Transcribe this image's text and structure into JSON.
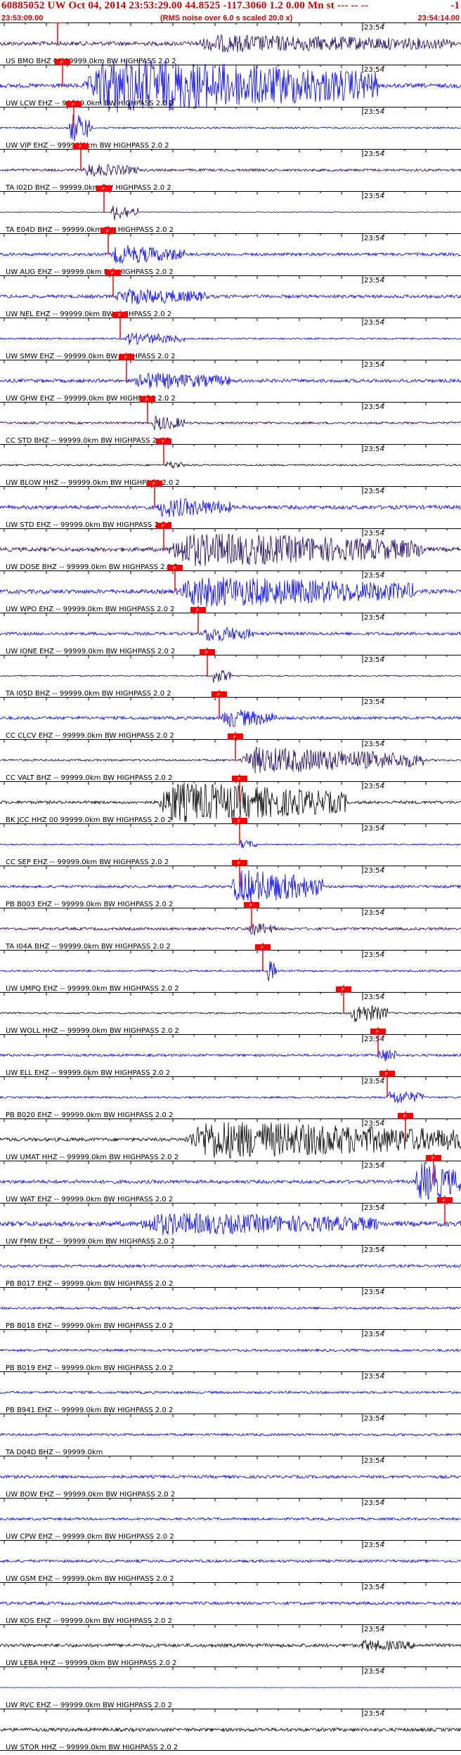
{
  "header": {
    "title": "60885052 UW Oct 04, 2014 23:53:29.00   44.8525 -117.3060  1.2 0.00 Mn st --- -- --",
    "trailing": "-1",
    "start_time": "23:53:09.00",
    "note": "(RMS noise over 6.0 s scaled 20.0 x)",
    "end_time": "23:54:14.00"
  },
  "tick_label": "23:54",
  "pick_label": "P",
  "colors": {
    "header": "#d40000",
    "pick": "#ff0000",
    "blue": "#0000ff",
    "navy": "#1a0066",
    "black": "#000000"
  },
  "traces": [
    {
      "label": "US BMO BHZ 00 99999.0km BW  HIGHPASS  2.0  2",
      "color": "#1a0066",
      "amp": 0.3,
      "burst": [
        0.42,
        0.98,
        1.0
      ],
      "pick": 0.125
    },
    {
      "label": "UW LCW EHZ -- 99999.0km BW  HIGHPASS  2.0  2",
      "color": "#0000ff",
      "amp": 0.3,
      "burst": [
        0.18,
        0.82,
        3.8
      ],
      "pick": 0.135
    },
    {
      "label": "UW VIP EHZ -- 99999.0km BW  HIGHPASS  2.0  2",
      "color": "#0000ff",
      "amp": 0.12,
      "burst": [
        0.15,
        0.2,
        2.2
      ],
      "pick": 0.16
    },
    {
      "label": "TA I02D BHZ -- 99999.0km BW  HIGHPASS  2.0  2",
      "color": "#1a0066",
      "amp": 0.18,
      "burst": [
        0.18,
        0.3,
        0.8
      ],
      "pick": 0.175
    },
    {
      "label": "TA E04D BHZ -- 99999.0km BW  HIGHPASS  2.0  2",
      "color": "#1a0066",
      "amp": 0.05,
      "burst": [
        0.24,
        0.3,
        1.2
      ],
      "pick": 0.225
    },
    {
      "label": "UW AUG EHZ -- 99999.0km BW  HIGHPASS  2.0  2",
      "color": "#0000ff",
      "amp": 0.22,
      "burst": [
        0.24,
        0.4,
        1.2
      ],
      "pick": 0.235
    },
    {
      "label": "UW NEL EHZ -- 99999.0km BW  HIGHPASS  2.0  2",
      "color": "#0000ff",
      "amp": 0.24,
      "burst": [
        0.25,
        0.45,
        1.0
      ],
      "pick": 0.245
    },
    {
      "label": "UW SMW EHZ -- 99999.0km BW  HIGHPASS  2.0  2",
      "color": "#0000ff",
      "amp": 0.12,
      "burst": [
        0.27,
        0.4,
        0.8
      ],
      "pick": 0.26
    },
    {
      "label": "UW GHW EHZ -- 99999.0km BW  HIGHPASS  2.0  2",
      "color": "#0000ff",
      "amp": 0.25,
      "burst": [
        0.29,
        0.5,
        1.0
      ],
      "pick": 0.275
    },
    {
      "label": "CC STD BHZ -- 99999.0km BW  HIGHPASS  2.0  2",
      "color": "#1a0066",
      "amp": 0.16,
      "burst": [
        0.33,
        0.4,
        1.0
      ],
      "pick": 0.32
    },
    {
      "label": "UW BLOW HHZ -- 99999.0km BW  HIGHPASS  2.0  2",
      "color": "#000000",
      "amp": 0.12,
      "burst": [
        0.36,
        0.4,
        0.5
      ],
      "pick": 0.355
    },
    {
      "label": "UW STD EHZ -- 99999.0km BW  HIGHPASS  2.0  2",
      "color": "#0000ff",
      "amp": 0.28,
      "burst": [
        0.34,
        0.5,
        1.2
      ],
      "pick": 0.335
    },
    {
      "label": "UW DOSE BHZ -- 99999.0km BW  HIGHPASS  2.0  2",
      "color": "#1a0066",
      "amp": 0.3,
      "burst": [
        0.36,
        0.92,
        2.2
      ],
      "pick": 0.355
    },
    {
      "label": "UW WPO EHZ -- 99999.0km BW  HIGHPASS  2.0  2",
      "color": "#0000ff",
      "amp": 0.3,
      "burst": [
        0.38,
        0.9,
        2.0
      ],
      "pick": 0.38
    },
    {
      "label": "UW IONE EHZ -- 99999.0km BW  HIGHPASS  2.0  2",
      "color": "#0000ff",
      "amp": 0.22,
      "burst": [
        0.44,
        0.55,
        1.0
      ],
      "pick": 0.43
    },
    {
      "label": "TA I05D BHZ -- 99999.0km BW  HIGHPASS  2.0  2",
      "color": "#1a0066",
      "amp": 0.1,
      "burst": [
        0.46,
        0.5,
        1.0
      ],
      "pick": 0.45
    },
    {
      "label": "CC CLCV EHZ -- 99999.0km BW  HIGHPASS  2.0  2",
      "color": "#0000ff",
      "amp": 0.22,
      "burst": [
        0.48,
        0.6,
        1.2
      ],
      "pick": 0.475
    },
    {
      "label": "CC VALT BHZ -- 99999.0km BW  HIGHPASS  2.0  2",
      "color": "#1a0066",
      "amp": 0.15,
      "burst": [
        0.52,
        0.92,
        1.8
      ],
      "pick": 0.51
    },
    {
      "label": "BK JCC HHZ 00 99999.0km BW  HIGHPASS  2.0  2",
      "color": "#000000",
      "amp": 0.22,
      "burst": [
        0.34,
        0.75,
        2.8
      ],
      "pick": 0.52
    },
    {
      "label": "CC SEP EHZ -- 99999.0km BW  HIGHPASS  2.0  2",
      "color": "#0000ff",
      "amp": 0.1,
      "burst": [
        0.52,
        0.56,
        0.6
      ],
      "pick": 0.52
    },
    {
      "label": "PB B003 EHZ -- 99999.0km BW  HIGHPASS  2.0  2",
      "color": "#0000ff",
      "amp": 0.2,
      "burst": [
        0.5,
        0.7,
        2.4
      ],
      "pick": 0.52
    },
    {
      "label": "TA I04A BHZ -- 99999.0km BW  HIGHPASS  2.0  2",
      "color": "#1a0066",
      "amp": 0.2,
      "burst": [
        0.54,
        0.6,
        0.8
      ],
      "pick": 0.545
    },
    {
      "label": "UW UMPQ EHZ -- 99999.0km BW  HIGHPASS  2.0  2",
      "color": "#0000ff",
      "amp": 0.14,
      "burst": [
        0.58,
        0.6,
        1.8
      ],
      "pick": 0.57
    },
    {
      "label": "UW WOLL HHZ -- 99999.0km BW  HIGHPASS  2.0  2",
      "color": "#000000",
      "amp": 0.12,
      "burst": [
        0.76,
        0.84,
        1.4
      ],
      "pick": 0.745
    },
    {
      "label": "UW ELL EHZ -- 99999.0km BW  HIGHPASS  2.0  2",
      "color": "#0000ff",
      "amp": 0.18,
      "burst": [
        0.82,
        0.86,
        1.0
      ],
      "pick": 0.82
    },
    {
      "label": "PB B020 EHZ -- 99999.0km BW  HIGHPASS  2.0  2",
      "color": "#0000ff",
      "amp": 0.14,
      "burst": [
        0.84,
        0.92,
        1.0
      ],
      "pick": 0.84
    },
    {
      "label": "UW UMAT HHZ -- 99999.0km BW  HIGHPASS  2.0  2",
      "color": "#000000",
      "amp": 0.25,
      "burst": [
        0.4,
        1.0,
        2.6
      ],
      "pick": 0.88
    },
    {
      "label": "UW WAT EHZ -- 99999.0km BW  HIGHPASS  2.0  2",
      "color": "#0000ff",
      "amp": 0.25,
      "burst": [
        0.9,
        1.0,
        2.8
      ],
      "pick": 0.94
    },
    {
      "label": "UW FMW EHZ -- 99999.0km BW  HIGHPASS  2.0  2",
      "color": "#0000ff",
      "amp": 0.35,
      "burst": [
        0.3,
        0.82,
        1.3
      ],
      "pick": 0.965
    },
    {
      "label": "PB B017 EHZ -- 99999.0km BW  HIGHPASS  2.0  2",
      "color": "#0000ff",
      "amp": 0.2,
      "burst": null
    },
    {
      "label": "PB B018 EHZ -- 99999.0km BW  HIGHPASS  2.0  2",
      "color": "#0000ff",
      "amp": 0.18,
      "burst": null
    },
    {
      "label": "PB B019 EHZ -- 99999.0km BW  HIGHPASS  2.0  2",
      "color": "#0000ff",
      "amp": 0.18,
      "burst": null
    },
    {
      "label": "PB B941 EHZ -- 99999.0km BW  HIGHPASS  2.0  2",
      "color": "#0000ff",
      "amp": 0.18,
      "burst": null
    },
    {
      "label": "TA D04D BHZ -- 99999.0km",
      "color": "#0000ff",
      "amp": 0.18,
      "burst": null
    },
    {
      "label": "UW BOW EHZ -- 99999.0km BW  HIGHPASS  2.0  2",
      "color": "#0000ff",
      "amp": 0.22,
      "burst": null
    },
    {
      "label": "UW CPW EHZ -- 99999.0km BW  HIGHPASS  2.0  2",
      "color": "#0000ff",
      "amp": 0.18,
      "burst": null
    },
    {
      "label": "UW GSM EHZ -- 99999.0km BW  HIGHPASS  2.0  2",
      "color": "#0000ff",
      "amp": 0.2,
      "burst": null
    },
    {
      "label": "UW KOS EHZ -- 99999.0km BW  HIGHPASS  2.0  2",
      "color": "#0000ff",
      "amp": 0.22,
      "burst": null
    },
    {
      "label": "UW LEBA HHZ -- 99999.0km BW  HIGHPASS  2.0  2",
      "color": "#000000",
      "amp": 0.25,
      "burst": [
        0.78,
        0.9,
        0.6
      ]
    },
    {
      "label": "UW RVC EHZ -- 99999.0km BW  HIGHPASS  2.0  2",
      "color": "#0000ff",
      "amp": 0.02,
      "burst": null
    },
    {
      "label": "UW STOR HHZ -- 99999.0km BW  HIGHPASS  2.0  2",
      "color": "#000000",
      "amp": 0.25,
      "burst": null
    }
  ]
}
